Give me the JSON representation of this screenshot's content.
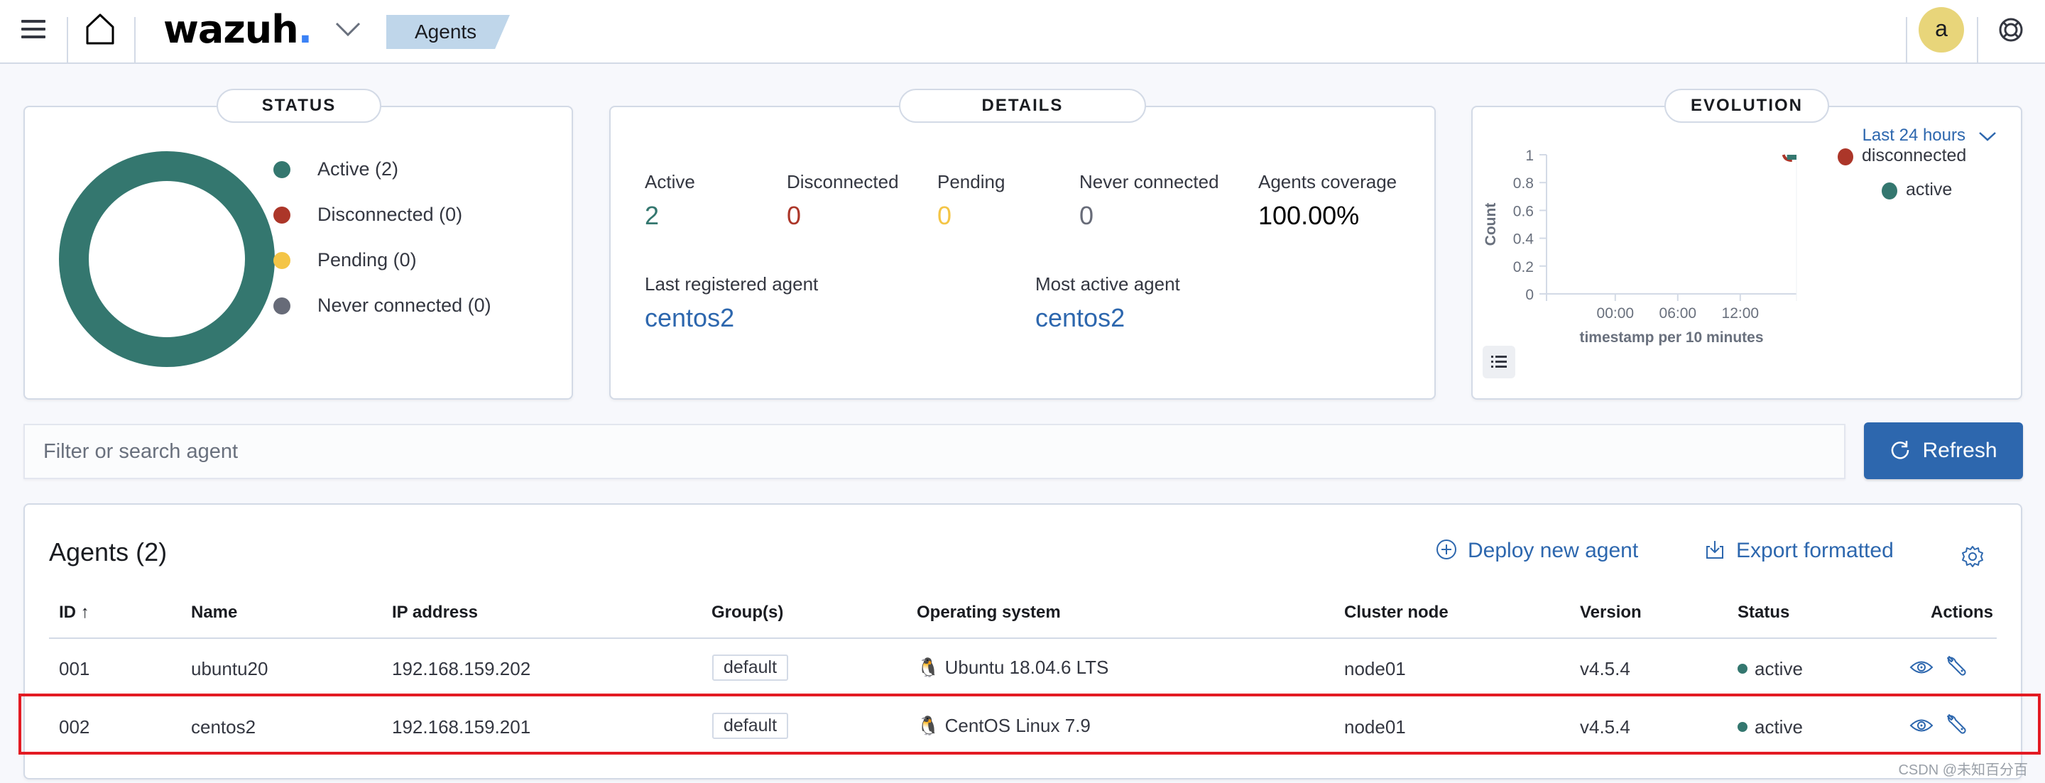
{
  "header": {
    "logo_text": "wazuh",
    "logo_dot": ".",
    "breadcrumb": "Agents",
    "avatar_letter": "a",
    "icons": [
      "menu-icon",
      "home-icon",
      "chevron-down-icon",
      "help-lifebuoy-icon"
    ]
  },
  "status": {
    "title": "STATUS",
    "legend": [
      {
        "label": "Active (2)",
        "color": "#34776f",
        "count": 2
      },
      {
        "label": "Disconnected (0)",
        "color": "#ac3629",
        "count": 0
      },
      {
        "label": "Pending (0)",
        "color": "#f4c546",
        "count": 0
      },
      {
        "label": "Never connected (0)",
        "color": "#676b78",
        "count": 0
      }
    ]
  },
  "details": {
    "title": "DETAILS",
    "stats": [
      {
        "label": "Active",
        "value": "2",
        "color": "#34776f"
      },
      {
        "label": "Disconnected",
        "value": "0",
        "color": "#ac3629"
      },
      {
        "label": "Pending",
        "value": "0",
        "color": "#f4c546"
      },
      {
        "label": "Never connected",
        "value": "0",
        "color": "#676b78"
      },
      {
        "label": "Agents coverage",
        "value": "100.00%",
        "color": "#000000"
      }
    ],
    "last_registered_label": "Last registered agent",
    "last_registered_value": "centos2",
    "most_active_label": "Most active agent",
    "most_active_value": "centos2"
  },
  "evolution": {
    "title": "EVOLUTION",
    "range_label": "Last 24 hours",
    "legend_list_icon": "list-icon"
  },
  "chart_data": {
    "type": "bar",
    "stacked": true,
    "title": "",
    "xlabel": "timestamp per 10 minutes",
    "ylabel": "Count",
    "ylim": [
      0,
      1
    ],
    "yticks": [
      "0",
      "0.2",
      "0.4",
      "0.6",
      "0.8",
      "1"
    ],
    "xticks": [
      "00:00",
      "06:00",
      "12:00"
    ],
    "x_domain_hours": [
      -6.6,
      17.4
    ],
    "series": [
      {
        "name": "disconnected",
        "color": "#ac3629",
        "points": [
          {
            "x_hours": 16.7,
            "value": 0
          }
        ]
      },
      {
        "name": "active",
        "color": "#34776f",
        "points": [
          {
            "x_hours": 16.9,
            "value": 1
          }
        ]
      }
    ],
    "legend_position": "top-right",
    "grid": false
  },
  "search": {
    "placeholder": "Filter or search agent"
  },
  "refresh_label": "Refresh",
  "agents": {
    "title": "Agents (2)",
    "deploy_label": "Deploy new agent",
    "export_label": "Export formatted",
    "columns": [
      "ID",
      "Name",
      "IP address",
      "Group(s)",
      "Operating system",
      "Cluster node",
      "Version",
      "Status",
      "Actions"
    ],
    "sort_indicator": "↑",
    "rows": [
      {
        "id": "001",
        "name": "ubuntu20",
        "ip": "192.168.159.202",
        "group": "default",
        "os": "Ubuntu 18.04.6 LTS",
        "node": "node01",
        "version": "v4.5.4",
        "status": "active"
      },
      {
        "id": "002",
        "name": "centos2",
        "ip": "192.168.159.201",
        "group": "default",
        "os": "CentOS Linux 7.9",
        "node": "node01",
        "version": "v4.5.4",
        "status": "active"
      }
    ]
  },
  "watermark": "CSDN @未知百分百"
}
